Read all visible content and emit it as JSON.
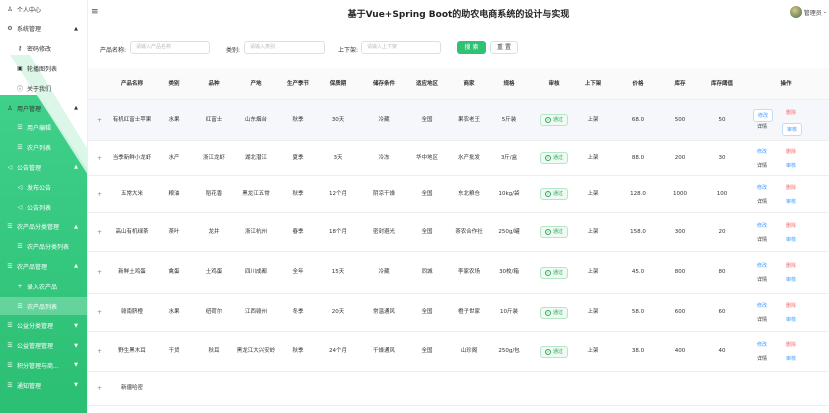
{
  "app": {
    "title": "基于Vue+Spring Boot的助农电商系统的设计与实现",
    "user": "管理员"
  },
  "sidebar": {
    "items": [
      {
        "label": "个人中心",
        "icon": "person-icon",
        "level": 1
      },
      {
        "label": "系统管理",
        "icon": "gear-icon",
        "level": 1,
        "chev": "▲"
      },
      {
        "label": "密码修改",
        "icon": "key-icon",
        "level": 2
      },
      {
        "label": "轮播图列表",
        "icon": "image-icon",
        "level": 2
      },
      {
        "label": "关于我们",
        "icon": "info-icon",
        "level": 2
      },
      {
        "label": "用户管理",
        "icon": "person-icon",
        "level": 1,
        "chev": "▲"
      },
      {
        "label": "用户编辑",
        "icon": "list-icon",
        "level": 2
      },
      {
        "label": "农户列表",
        "icon": "list-icon",
        "level": 2
      },
      {
        "label": "公告管理",
        "icon": "speaker-icon",
        "level": 1,
        "chev": "▲"
      },
      {
        "label": "发布公告",
        "icon": "speaker-icon",
        "level": 2
      },
      {
        "label": "公告列表",
        "icon": "speaker-icon",
        "level": 2
      },
      {
        "label": "农产品分类管理",
        "icon": "list-icon",
        "level": 1,
        "chev": "▲"
      },
      {
        "label": "农产品分类列表",
        "icon": "list-icon",
        "level": 2
      },
      {
        "label": "农产品管理",
        "icon": "list-icon",
        "level": 1,
        "chev": "▲"
      },
      {
        "label": "录入农产品",
        "icon": "plus-icon",
        "level": 2
      },
      {
        "label": "农产品列表",
        "icon": "list-icon",
        "level": 2,
        "active": true
      },
      {
        "label": "公益分类管理",
        "icon": "list-icon",
        "level": 1,
        "chev": "▼"
      },
      {
        "label": "公益管理管理",
        "icon": "list-icon",
        "level": 1,
        "chev": "▼"
      },
      {
        "label": "积分管理与商...",
        "icon": "list-icon",
        "level": 1,
        "chev": "▼"
      },
      {
        "label": "通知管理",
        "icon": "list-icon",
        "level": 1,
        "chev": "▼"
      }
    ]
  },
  "search": {
    "name_label": "产品名称:",
    "name_placeholder": "请输入产品名称",
    "category_label": "类别:",
    "category_placeholder": "请输入类别",
    "status_label": "上下架:",
    "status_placeholder": "请输入上下架",
    "search_btn": "搜 索",
    "reset_btn": "重 置"
  },
  "table": {
    "headers": [
      "产品名称",
      "类别",
      "品种",
      "产地",
      "生产季节",
      "保质期",
      "储存条件",
      "适应地区",
      "商家",
      "规格",
      "审核",
      "上下架",
      "价格",
      "库存",
      "库存阈值",
      "操作"
    ],
    "rows": [
      {
        "name": "有机红富士苹果",
        "cat": "水果",
        "variety": "红富士",
        "origin": "山东烟台",
        "season": "秋季",
        "shelf": "30天",
        "storage": "冷藏",
        "region": "全国",
        "seller": "果农老王",
        "spec": "5斤装",
        "audit": "通过",
        "status": "上架",
        "price": "68.0",
        "stock": "500",
        "threshold": "50"
      },
      {
        "name": "当季新鲜小龙虾",
        "cat": "水产",
        "variety": "浙江龙虾",
        "origin": "湖北潜江",
        "season": "夏季",
        "shelf": "3天",
        "storage": "冷冻",
        "region": "华中地区",
        "seller": "水产批发",
        "spec": "3斤/盒",
        "audit": "通过",
        "status": "上架",
        "price": "88.0",
        "stock": "200",
        "threshold": "30"
      },
      {
        "name": "五常大米",
        "cat": "粮油",
        "variety": "稻花香",
        "origin": "黑龙江五常",
        "season": "秋季",
        "shelf": "12个月",
        "storage": "阴凉干燥",
        "region": "全国",
        "seller": "东北粮仓",
        "spec": "10kg/袋",
        "audit": "通过",
        "status": "上架",
        "price": "128.0",
        "stock": "1000",
        "threshold": "100"
      },
      {
        "name": "高山有机绿茶",
        "cat": "茶叶",
        "variety": "龙井",
        "origin": "浙江杭州",
        "season": "春季",
        "shelf": "18个月",
        "storage": "密封避光",
        "region": "全国",
        "seller": "茶农合作社",
        "spec": "250g/罐",
        "audit": "通过",
        "status": "上架",
        "price": "158.0",
        "stock": "300",
        "threshold": "20"
      },
      {
        "name": "新鲜土鸡蛋",
        "cat": "禽蛋",
        "variety": "土鸡蛋",
        "origin": "四川成都",
        "season": "全年",
        "shelf": "15天",
        "storage": "冷藏",
        "region": "同城",
        "seller": "李家农场",
        "spec": "30枚/箱",
        "audit": "通过",
        "status": "上架",
        "price": "45.0",
        "stock": "800",
        "threshold": "80"
      },
      {
        "name": "赣南脐橙",
        "cat": "水果",
        "variety": "纽荷尔",
        "origin": "江西赣州",
        "season": "冬季",
        "shelf": "20天",
        "storage": "常温通风",
        "region": "全国",
        "seller": "橙子世家",
        "spec": "10斤装",
        "audit": "通过",
        "status": "上架",
        "price": "58.0",
        "stock": "600",
        "threshold": "60"
      },
      {
        "name": "野生黑木耳",
        "cat": "干货",
        "variety": "秋耳",
        "origin": "黑龙江大兴安岭",
        "season": "秋季",
        "shelf": "24个月",
        "storage": "干燥通风",
        "region": "全国",
        "seller": "山珍阁",
        "spec": "250g/包",
        "audit": "通过",
        "status": "上架",
        "price": "38.0",
        "stock": "400",
        "threshold": "40"
      },
      {
        "name": "新疆哈密",
        "cat": "",
        "variety": "",
        "origin": "",
        "season": "",
        "shelf": "",
        "storage": "",
        "region": "",
        "seller": "",
        "spec": "",
        "audit": "",
        "status": "",
        "price": "",
        "stock": "",
        "threshold": ""
      }
    ],
    "ops": {
      "edit": "修改",
      "delete": "删除",
      "detail": "详情",
      "review": "审核"
    },
    "expand_icon": "+"
  }
}
